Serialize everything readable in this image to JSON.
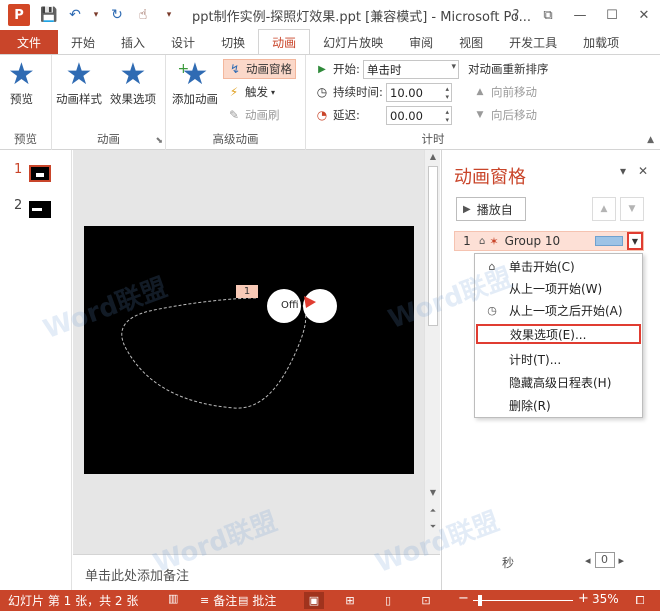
{
  "titlebar": {
    "title": "ppt制作实例-探照灯效果.ppt [兼容模式] - Microsoft Po...",
    "logo": "P",
    "qa_icons": [
      "save-icon",
      "undo-icon",
      "redo-icon",
      "touch-mode-icon"
    ],
    "controls": [
      "?",
      "⧉",
      "—",
      "☐",
      "✕"
    ]
  },
  "tabs": [
    "文件",
    "开始",
    "插入",
    "设计",
    "切换",
    "动画",
    "幻灯片放映",
    "审阅",
    "视图",
    "开发工具",
    "加载项"
  ],
  "ribbon": {
    "preview": {
      "label": "预览",
      "group": "预览"
    },
    "animation": {
      "style_label": "动画样式",
      "options_label": "效果选项",
      "group": "动画"
    },
    "advanced": {
      "add_label": "添加动画",
      "pane_label": "动画窗格",
      "trigger_label": "触发",
      "painter_label": "动画刷",
      "group": "高级动画"
    },
    "timing": {
      "start_label": "开始:",
      "start_value": "单击时",
      "duration_label": "持续时间:",
      "duration_value": "10.00",
      "delay_label": "延迟:",
      "delay_value": "00.00",
      "reorder_label": "对动画重新排序",
      "move_earlier": "向前移动",
      "move_later": "向后移动",
      "group": "计时"
    }
  },
  "slides": {
    "items": [
      {
        "num": "1",
        "selected": true
      },
      {
        "num": "2",
        "selected": false
      }
    ]
  },
  "slide_content": {
    "tag": "1",
    "text": "Offi"
  },
  "notes": {
    "placeholder": "单击此处添加备注"
  },
  "pane": {
    "title": "动画窗格",
    "play_label": "播放自",
    "item": {
      "index": "1",
      "name": "Group 10"
    },
    "footer_unit": "秒",
    "footer_zoom": "0"
  },
  "menu": {
    "items": [
      {
        "label": "单击开始(C)",
        "icon": "mouse-icon"
      },
      {
        "label": "从上一项开始(W)",
        "icon": ""
      },
      {
        "label": "从上一项之后开始(A)",
        "icon": "clock-icon"
      },
      {
        "label": "效果选项(E)...",
        "icon": ""
      },
      {
        "label": "计时(T)...",
        "icon": ""
      },
      {
        "label": "隐藏高级日程表(H)",
        "icon": ""
      },
      {
        "label": "删除(R)",
        "icon": ""
      }
    ]
  },
  "status": {
    "slide_info": "幻灯片 第 1 张，共 2 张",
    "notes_label": "备注",
    "comments_label": "批注",
    "zoom": "35%"
  },
  "watermark": "Word联盟",
  "colors": {
    "accent": "#c9452a",
    "highlight_box": "#e03c31",
    "icon_blue": "#2f6bb3"
  }
}
